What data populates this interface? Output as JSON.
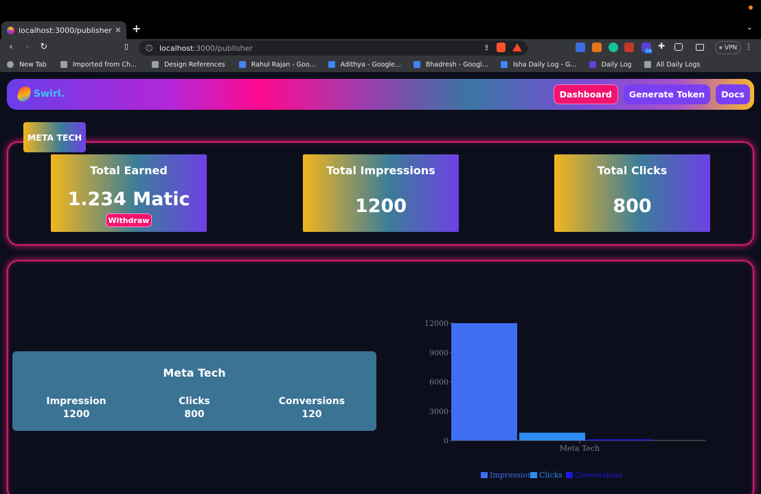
{
  "browser": {
    "tab_title": "localhost:3000/publisher",
    "url_host": "localhost",
    "url_path": ":3000/publisher",
    "vpn_label": "VPN",
    "extension_badge": "14",
    "bookmarks": [
      {
        "label": "New Tab",
        "icon": "globe-icon"
      },
      {
        "label": "Imported from Ch...",
        "icon": "folder-icon"
      },
      {
        "label": "Design References",
        "icon": "folder-icon"
      },
      {
        "label": "Rahul Rajan - Goo...",
        "icon": "doc-icon"
      },
      {
        "label": "Adithya - Google...",
        "icon": "doc-icon"
      },
      {
        "label": "Bhadresh - Googl...",
        "icon": "doc-icon"
      },
      {
        "label": "Isha Daily Log - G...",
        "icon": "doc-icon"
      },
      {
        "label": "Daily Log",
        "icon": "list-icon"
      },
      {
        "label": "All Daily Logs",
        "icon": "folder-icon"
      }
    ]
  },
  "app": {
    "logo_text": "Swirl.",
    "nav": {
      "dashboard": "Dashboard",
      "generate_token": "Generate Token",
      "docs": "Docs"
    },
    "company_tag": "META TECH",
    "stats": {
      "earned_title": "Total Earned",
      "earned_value": "1.234 Matic",
      "withdraw_label": "Withdraw",
      "impressions_title": "Total Impressions",
      "impressions_value": "1200",
      "clicks_title": "Total Clicks",
      "clicks_value": "800"
    },
    "summary": {
      "title": "Meta Tech",
      "impression_label": "Impression",
      "impression_value": "1200",
      "clicks_label": "Clicks",
      "clicks_value": "800",
      "conversions_label": "Conversions",
      "conversions_value": "120"
    },
    "colors": {
      "accent_pink": "#f2136f",
      "accent_purple": "#7b3ff2",
      "panel_border": "#d41d74"
    }
  },
  "chart_data": {
    "type": "bar",
    "categories": [
      "Meta Tech"
    ],
    "series": [
      {
        "name": "Impressions",
        "values": [
          12000
        ],
        "color": "#3f6ef3"
      },
      {
        "name": "Clicks",
        "values": [
          800
        ],
        "color": "#2d8cf0"
      },
      {
        "name": "Conversions",
        "values": [
          120
        ],
        "color": "#1a1ae0"
      }
    ],
    "y_ticks": [
      "0",
      "3000",
      "6000",
      "9000",
      "12000"
    ],
    "ylim": [
      0,
      12000
    ],
    "legend_position": "bottom"
  }
}
